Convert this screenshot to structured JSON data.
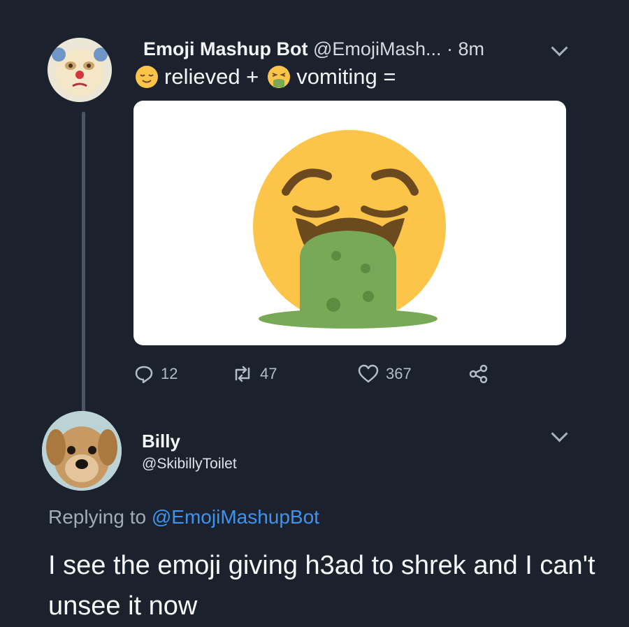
{
  "tweet": {
    "author_name": "Emoji Mashup Bot",
    "author_handle": "@EmojiMash...",
    "time": "· 8m",
    "text_part1": "relieved +",
    "text_part2": "vomiting =",
    "emoji1": "relieved-face-icon",
    "emoji2": "vomiting-face-icon",
    "stats": {
      "replies": "12",
      "retweets": "47",
      "likes": "367"
    }
  },
  "reply": {
    "author_name": "Billy",
    "author_handle": "@SkibillyToilet",
    "replying_label": "Replying to",
    "replying_handle": "@EmojiMashupBot",
    "text": "I see the emoji giving h3ad to shrek and I can't unsee it now"
  },
  "colors": {
    "background": "#1b222e",
    "mention": "#3b93f2",
    "emoji_yellow": "#fcc54a",
    "vomit_green": "#77a956"
  }
}
